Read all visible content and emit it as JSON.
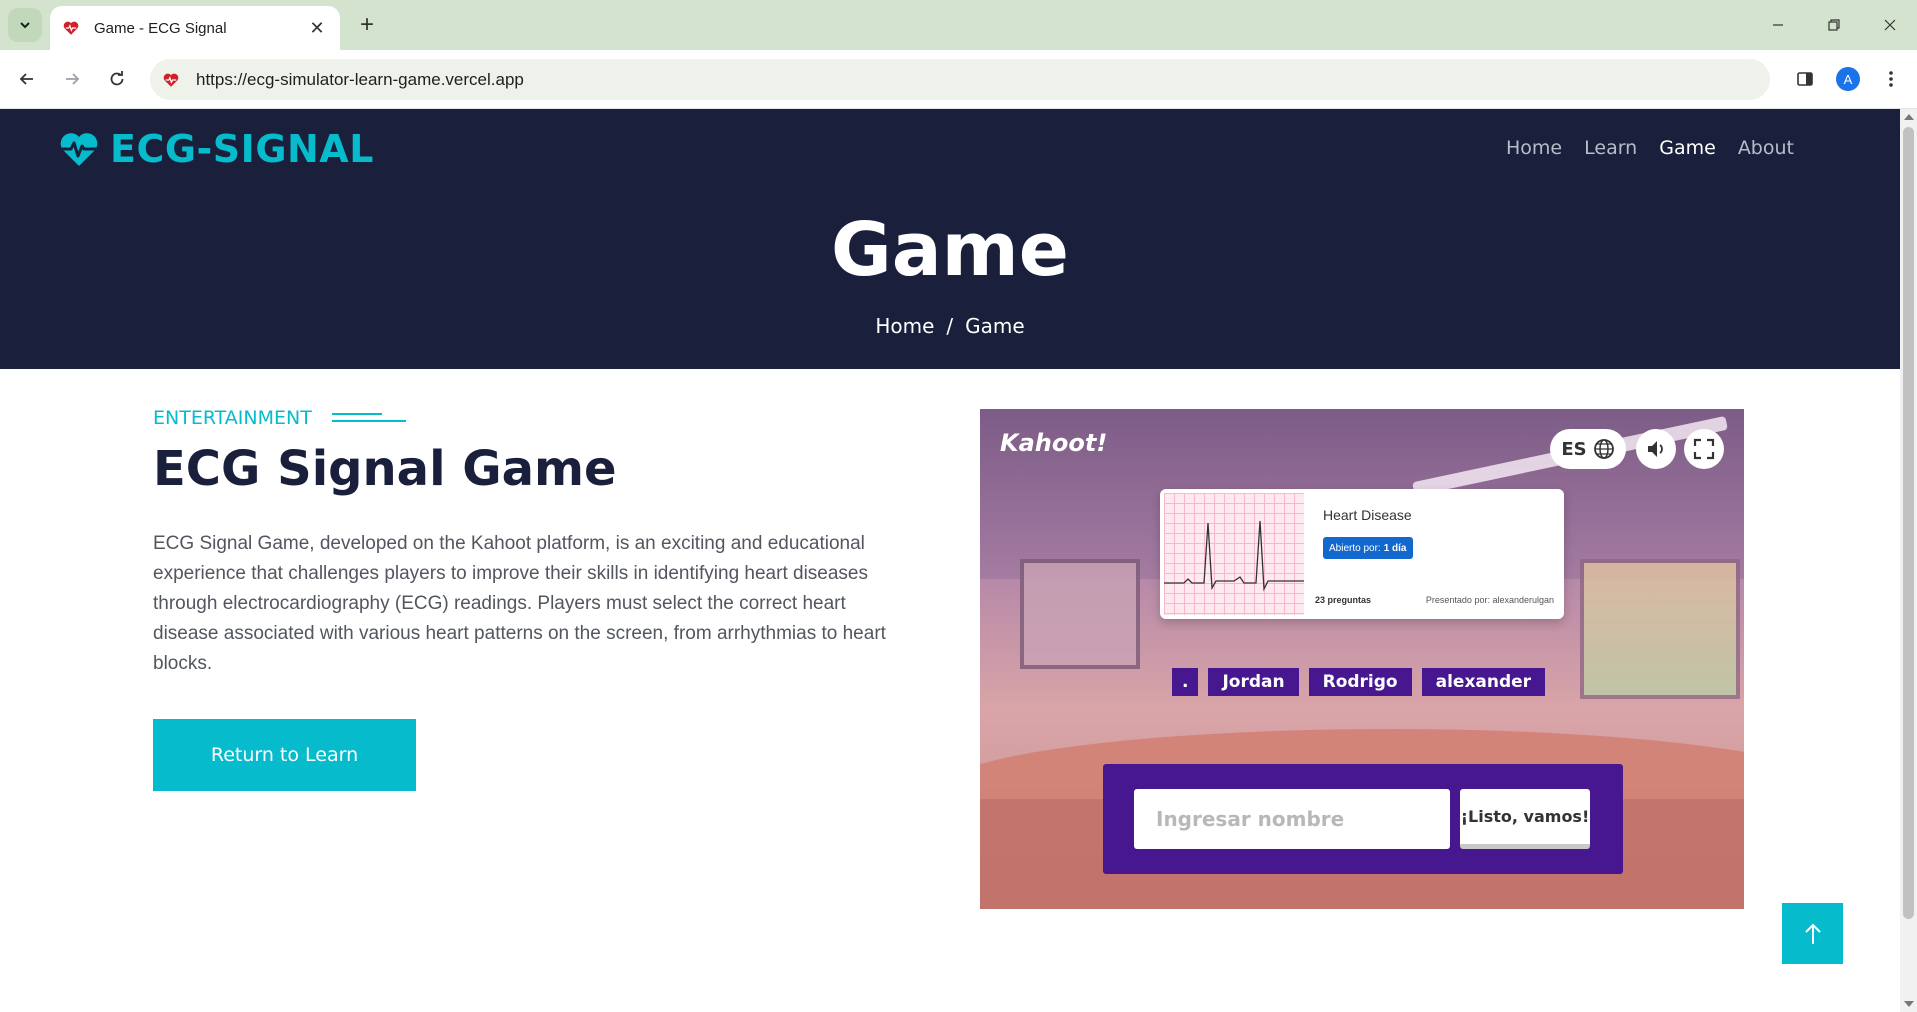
{
  "browser": {
    "tab_title": "Game - ECG Signal",
    "url": "https://ecg-simulator-learn-game.vercel.app",
    "profile_initial": "A"
  },
  "site": {
    "logo_text": "ECG-SIGNAL",
    "nav": [
      {
        "label": "Home",
        "active": false
      },
      {
        "label": "Learn",
        "active": false
      },
      {
        "label": "Game",
        "active": true
      },
      {
        "label": "About",
        "active": false
      }
    ],
    "accent_color": "#06bbcc",
    "dark_color": "#1a1f3b"
  },
  "hero": {
    "title": "Game",
    "breadcrumb": {
      "home": "Home",
      "separator": "/",
      "current": "Game"
    }
  },
  "section": {
    "eyebrow": "ENTERTAINMENT",
    "title": "ECG Signal Game",
    "description": "ECG Signal Game, developed on the Kahoot platform, is an exciting and educational experience that challenges players to improve their skills in identifying heart diseases through electrocardiography (ECG) readings. Players must select the correct heart disease associated with various heart patterns on the screen, from arrhythmias to heart blocks.",
    "cta_label": "Return to Learn"
  },
  "kahoot": {
    "brand": "Kahoot!",
    "language": "ES",
    "card": {
      "title": "Heart Disease",
      "badge_prefix": "Abierto por:",
      "badge_value": "1 día",
      "questions": "23 preguntas",
      "presented_by": "Presentado por: alexanderulgan"
    },
    "players": [
      ".",
      "Jordan",
      "Rodrigo",
      "alexander"
    ],
    "name_placeholder": "Ingresar nombre",
    "go_label": "¡Listo, vamos!",
    "purple": "#46178f"
  }
}
